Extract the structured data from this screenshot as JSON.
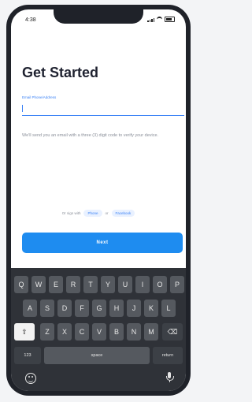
{
  "status_bar": {
    "time": "4:38",
    "icons": [
      "signal-icon",
      "wifi-icon",
      "battery-icon"
    ]
  },
  "screen": {
    "title": "Get Started",
    "email_label": "Email Phone/Address",
    "email_value": "",
    "info_text": "We'll send you an email with a three (3) digit code to verify your device.",
    "signin_prefix": "Or sign with",
    "signin_google": "Phone",
    "signin_separator": "or",
    "signin_facebook": "Facebook",
    "next_button": "Next"
  },
  "keyboard": {
    "row1": [
      "Q",
      "W",
      "E",
      "R",
      "T",
      "Y",
      "U",
      "I",
      "O",
      "P"
    ],
    "row2": [
      "A",
      "S",
      "D",
      "F",
      "G",
      "H",
      "J",
      "K",
      "L"
    ],
    "row3": [
      "Z",
      "X",
      "C",
      "V",
      "B",
      "N",
      "M"
    ],
    "shift_icon": "shift-icon",
    "backspace_icon": "backspace-icon",
    "num_key": "123",
    "space_key": "space",
    "return_key": "return",
    "emoji_icon": "emoji-icon",
    "mic_icon": "microphone-icon"
  },
  "colors": {
    "accent": "#1e8cf0",
    "keyboard_bg": "#2f3238",
    "key_bg": "#55595f"
  }
}
